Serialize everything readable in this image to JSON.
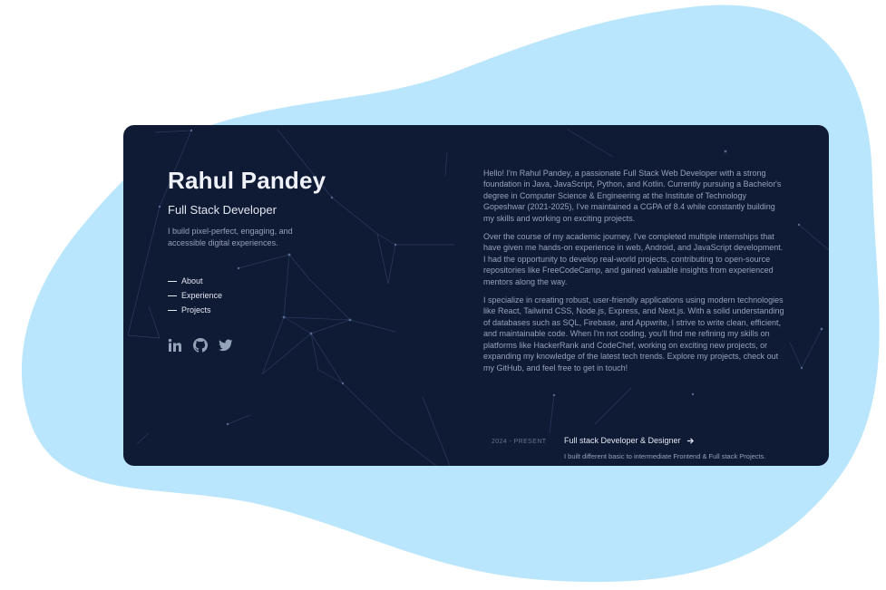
{
  "colors": {
    "background_blob": "#bae6fd",
    "card": "#0f1a35",
    "heading": "#eef2f8",
    "muted": "#94a3b8"
  },
  "profile": {
    "name": "Rahul Pandey",
    "role": "Full Stack Developer",
    "tagline": "I build pixel-perfect, engaging, and accessible digital experiences."
  },
  "nav": {
    "items": [
      {
        "label": "About"
      },
      {
        "label": "Experience"
      },
      {
        "label": "Projects"
      }
    ]
  },
  "socials": {
    "items": [
      {
        "icon": "linkedin-icon"
      },
      {
        "icon": "github-icon"
      },
      {
        "icon": "twitter-icon"
      }
    ]
  },
  "about": {
    "paragraphs": [
      "Hello! I'm Rahul Pandey, a passionate Full Stack Web Developer with a strong foundation in Java, JavaScript, Python, and Kotlin. Currently pursuing a Bachelor's degree in Computer Science & Engineering at the Institute of Technology Gopeshwar (2021-2025), I've maintained a CGPA of 8.4 while constantly building my skills and working on exciting projects.",
      "Over the course of my academic journey, I've completed multiple internships that have given me hands-on experience in web, Android, and JavaScript development. I had the opportunity to develop real-world projects, contributing to open-source repositories like FreeCodeCamp, and gained valuable insights from experienced mentors along the way.",
      "I specialize in creating robust, user-friendly applications using modern technologies like React, Tailwind CSS, Node.js, Express, and Next.js. With a solid understanding of databases such as SQL, Firebase, and Appwrite, I strive to write clean, efficient, and maintainable code. When I'm not coding, you'll find me refining my skills on platforms like HackerRank and CodeChef, working on exciting new projects, or expanding my knowledge of the latest tech trends. Explore my projects, check out my GitHub, and feel free to get in touch!"
    ]
  },
  "experience": {
    "date": "2024 - PRESENT",
    "title": "Full stack Developer & Designer",
    "arrow_icon": "arrow-right-icon",
    "description": "I built different basic to intermediate Frontend & Full stack Projects."
  }
}
